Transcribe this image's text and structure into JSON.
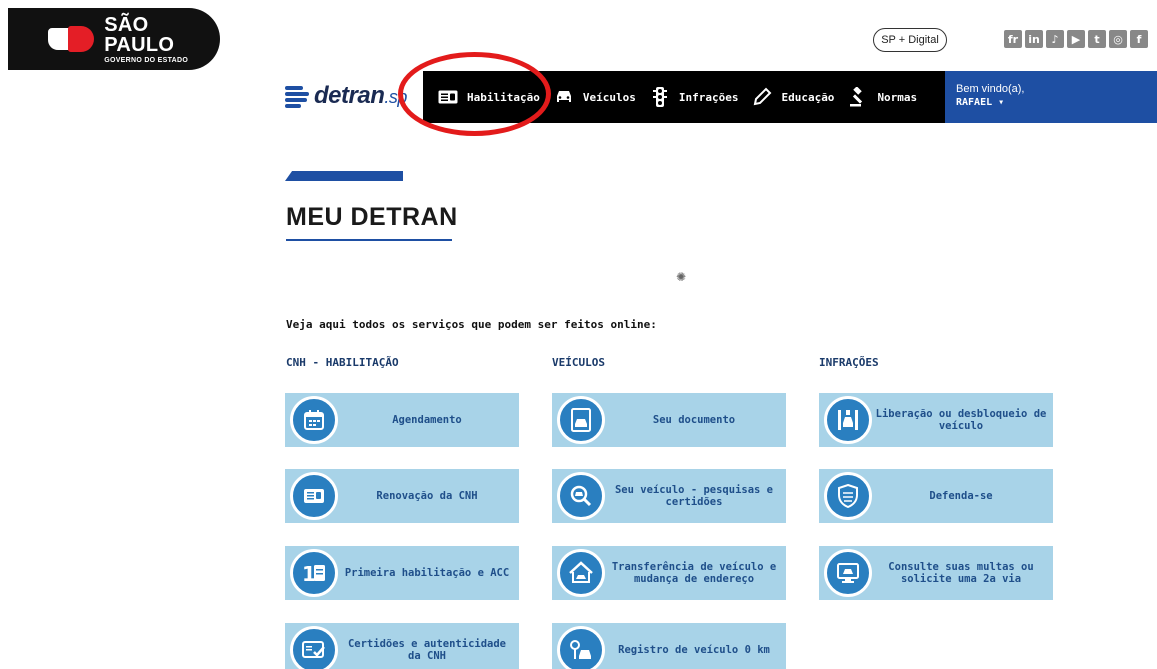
{
  "header": {
    "brand_title": "SÃO PAULO",
    "brand_subtitle": "GOVERNO DO ESTADO",
    "digital_button": "SP + Digital",
    "social_icons": [
      "flickr-icon",
      "linkedin-icon",
      "tiktok-icon",
      "youtube-icon",
      "twitter-icon",
      "instagram-icon",
      "facebook-icon"
    ]
  },
  "logo": {
    "main": "detran",
    "suffix": ".sp"
  },
  "nav": {
    "items": [
      {
        "label": "Habilitação",
        "icon": "license-card-icon"
      },
      {
        "label": "Veículos",
        "icon": "car-icon"
      },
      {
        "label": "Infrações",
        "icon": "traffic-light-icon"
      },
      {
        "label": "Educação",
        "icon": "pencil-icon"
      },
      {
        "label": "Normas",
        "icon": "gavel-icon"
      }
    ]
  },
  "user": {
    "greeting": "Bem vindo(a),",
    "name": "RAFAEL ▾"
  },
  "main": {
    "title": "MEU DETRAN",
    "intro": "Veja aqui todos os serviços que podem ser feitos online:",
    "columns": [
      {
        "title": "CNH - HABILITAÇÃO",
        "cards": [
          {
            "label": "Agendamento",
            "icon": "calendar-icon"
          },
          {
            "label": "Renovação da CNH",
            "icon": "license-card-icon"
          },
          {
            "label": "Primeira habilitação e ACC",
            "icon": "first-license-icon"
          },
          {
            "label": "Certidões e autenticidade da CNH",
            "icon": "certificate-icon"
          }
        ]
      },
      {
        "title": "VEÍCULOS",
        "cards": [
          {
            "label": "Seu documento",
            "icon": "document-icon"
          },
          {
            "label": "Seu veículo - pesquisas e certidões",
            "icon": "search-car-icon"
          },
          {
            "label": "Transferência de veículo e mudança de endereço",
            "icon": "house-transfer-icon"
          },
          {
            "label": "Registro de veículo 0 km",
            "icon": "new-car-icon"
          }
        ]
      },
      {
        "title": "INFRAÇÕES",
        "cards": [
          {
            "label": "Liberação ou desbloqueio de veículo",
            "icon": "unlock-car-icon"
          },
          {
            "label": "Defenda-se",
            "icon": "shield-icon"
          },
          {
            "label": "Consulte suas multas ou solicite uma 2a via",
            "icon": "computer-icon"
          }
        ]
      }
    ]
  },
  "colors": {
    "brand_blue": "#1e4fa3",
    "card_bg": "#a8d3e8",
    "icon_bg": "#2a7fc0",
    "annotation_red": "#e31b1b"
  }
}
